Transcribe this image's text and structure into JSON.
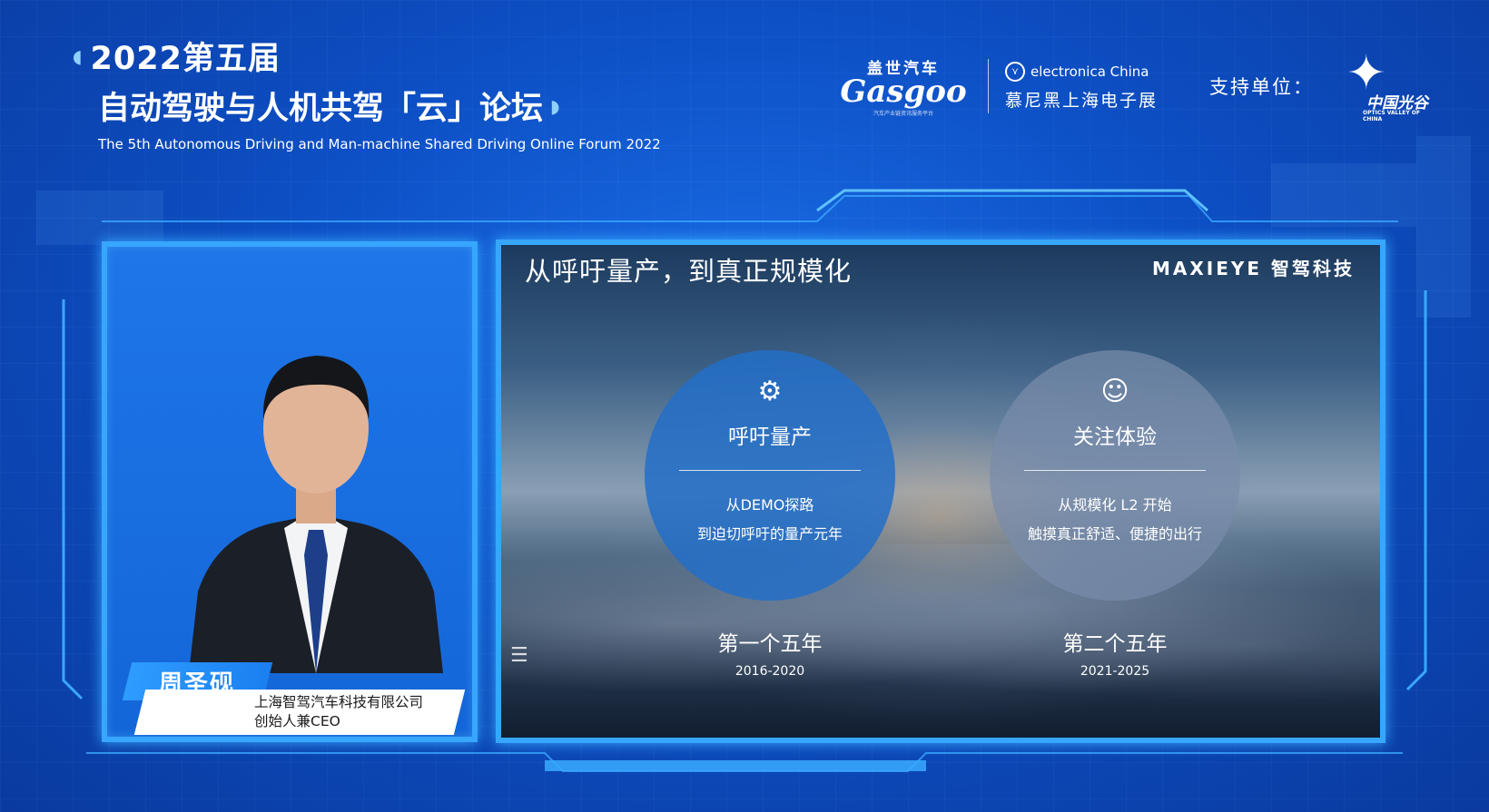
{
  "header": {
    "title_line1": "2022第五届",
    "title_line2": "自动驾驶与人机共驾「云」论坛",
    "title_en": "The 5th Autonomous Driving and Man-machine Shared Driving Online Forum 2022"
  },
  "logos": {
    "gasgoo_cn": "盖世汽车",
    "gasgoo_en": "Gasgoo",
    "gasgoo_sub": "汽车产业链资讯服务平台",
    "electronica_en": "electronica China",
    "electronica_cn": "慕尼黑上海电子展",
    "support_label": "支持单位：",
    "optics_cn": "中国光谷",
    "optics_en": "OPTICS VALLEY OF CHINA"
  },
  "speaker": {
    "name": "周圣砚",
    "company": "上海智驾汽车科技有限公司",
    "role": "创始人兼CEO"
  },
  "slide": {
    "title": "从呼吁量产，到真正规模化",
    "brand": "MAXIEYE 智驾科技",
    "stages": [
      {
        "icon": "robot-arm-icon",
        "heading": "呼吁量产",
        "desc_line1": "从DEMO探路",
        "desc_line2": "到迫切呼吁的量产元年",
        "period_title": "第一个五年",
        "period_years": "2016-2020"
      },
      {
        "icon": "smile-chat-icon",
        "heading": "关注体验",
        "desc_line1": "从规模化 L2 开始",
        "desc_line2": "触摸真正舒适、便捷的出行",
        "period_title": "第二个五年",
        "period_years": "2021-2025"
      }
    ]
  },
  "colors": {
    "frame": "#37a6ff",
    "background": "#0d4fc4",
    "circle_1": "#236ec8",
    "circle_2": "#788caa"
  }
}
